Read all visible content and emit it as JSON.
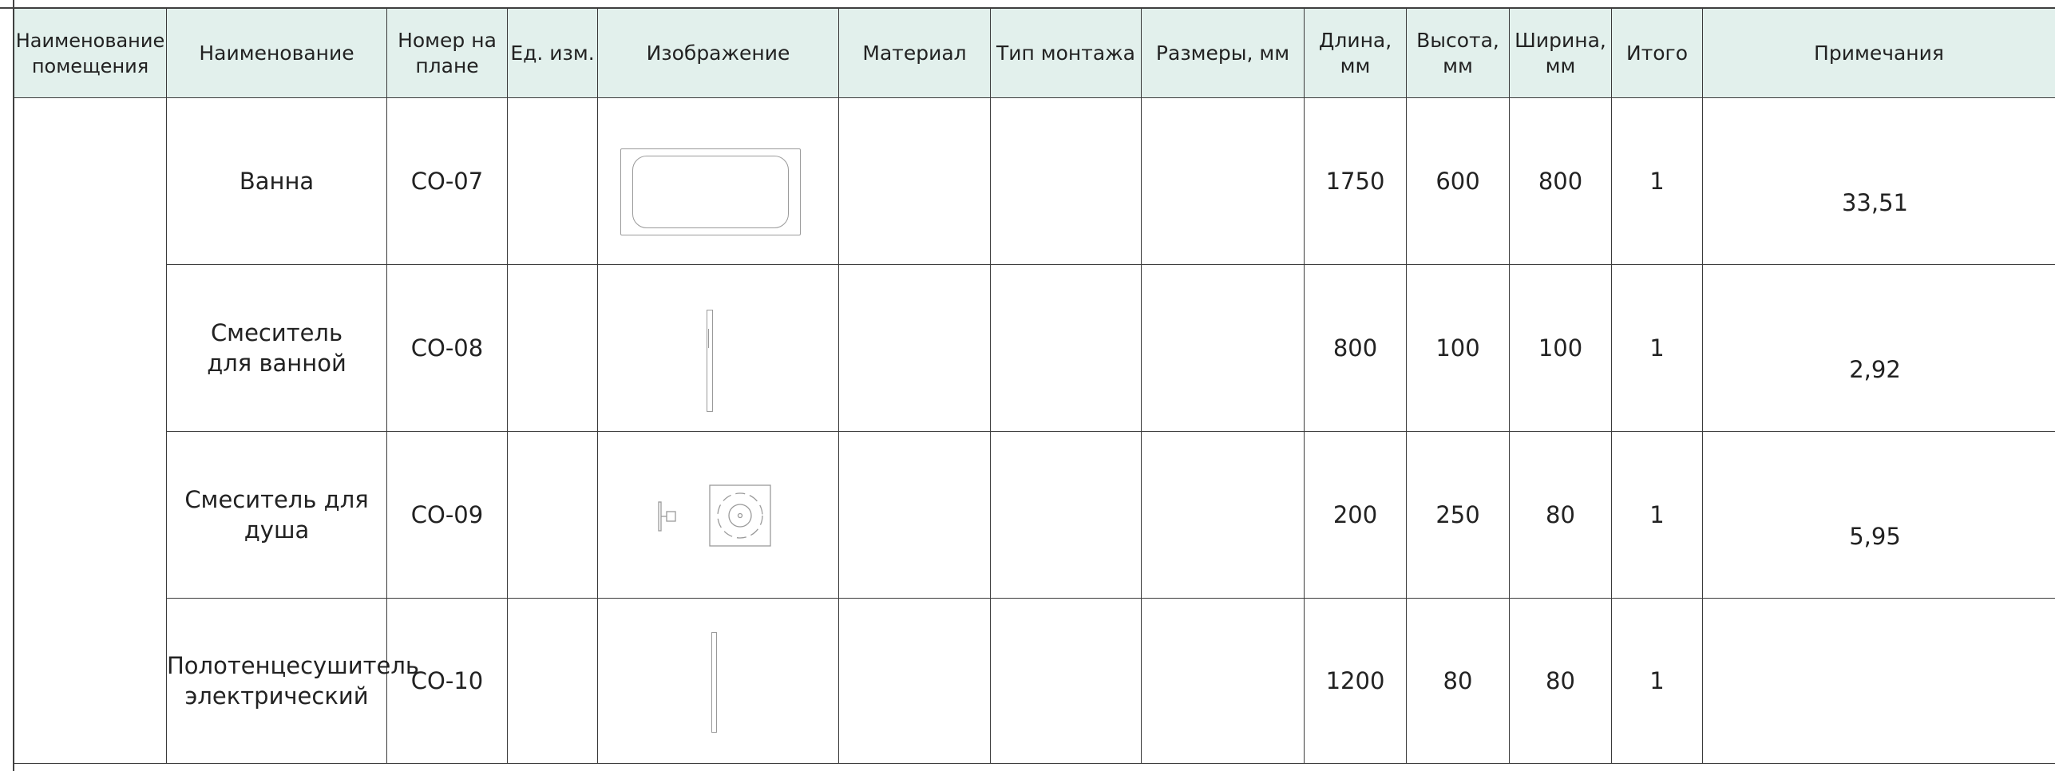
{
  "columns": [
    "Наименование\nпомещения",
    "Наименование",
    "Номер на\nплане",
    "Ед. изм.",
    "Изображение",
    "Материал",
    "Тип монтажа",
    "Размеры, мм",
    "Длина,\nмм",
    "Высота,\nмм",
    "Ширина,\nмм",
    "Итого",
    "Примечания"
  ],
  "rows": [
    {
      "name": "Ванна",
      "code": "СО-07",
      "unit": "",
      "image_icon": "bathtub-icon",
      "material": "",
      "mount": "",
      "dims": "",
      "length": "1750",
      "height": "600",
      "width": "800",
      "total": "1",
      "note": "33,51"
    },
    {
      "name": "Смеситель\nдля ванной",
      "code": "СО-08",
      "unit": "",
      "image_icon": "bath-mixer-icon",
      "material": "",
      "mount": "",
      "dims": "",
      "length": "800",
      "height": "100",
      "width": "100",
      "total": "1",
      "note": "2,92"
    },
    {
      "name": "Смеситель для\nдуша",
      "code": "СО-09",
      "unit": "",
      "image_icon": "shower-mixer-icon",
      "material": "",
      "mount": "",
      "dims": "",
      "length": "200",
      "height": "250",
      "width": "80",
      "total": "1",
      "note": "5,95"
    },
    {
      "name": "Полотенцесушитель\nэлектрический",
      "code": "СО-10",
      "unit": "",
      "image_icon": "towel-warmer-icon",
      "material": "",
      "mount": "",
      "dims": "",
      "length": "1200",
      "height": "80",
      "width": "80",
      "total": "1",
      "note": ""
    }
  ],
  "colors": {
    "header_bg": "#e2f0ec",
    "border": "#3a3a3a",
    "icon_stroke": "#9a9a9a"
  }
}
